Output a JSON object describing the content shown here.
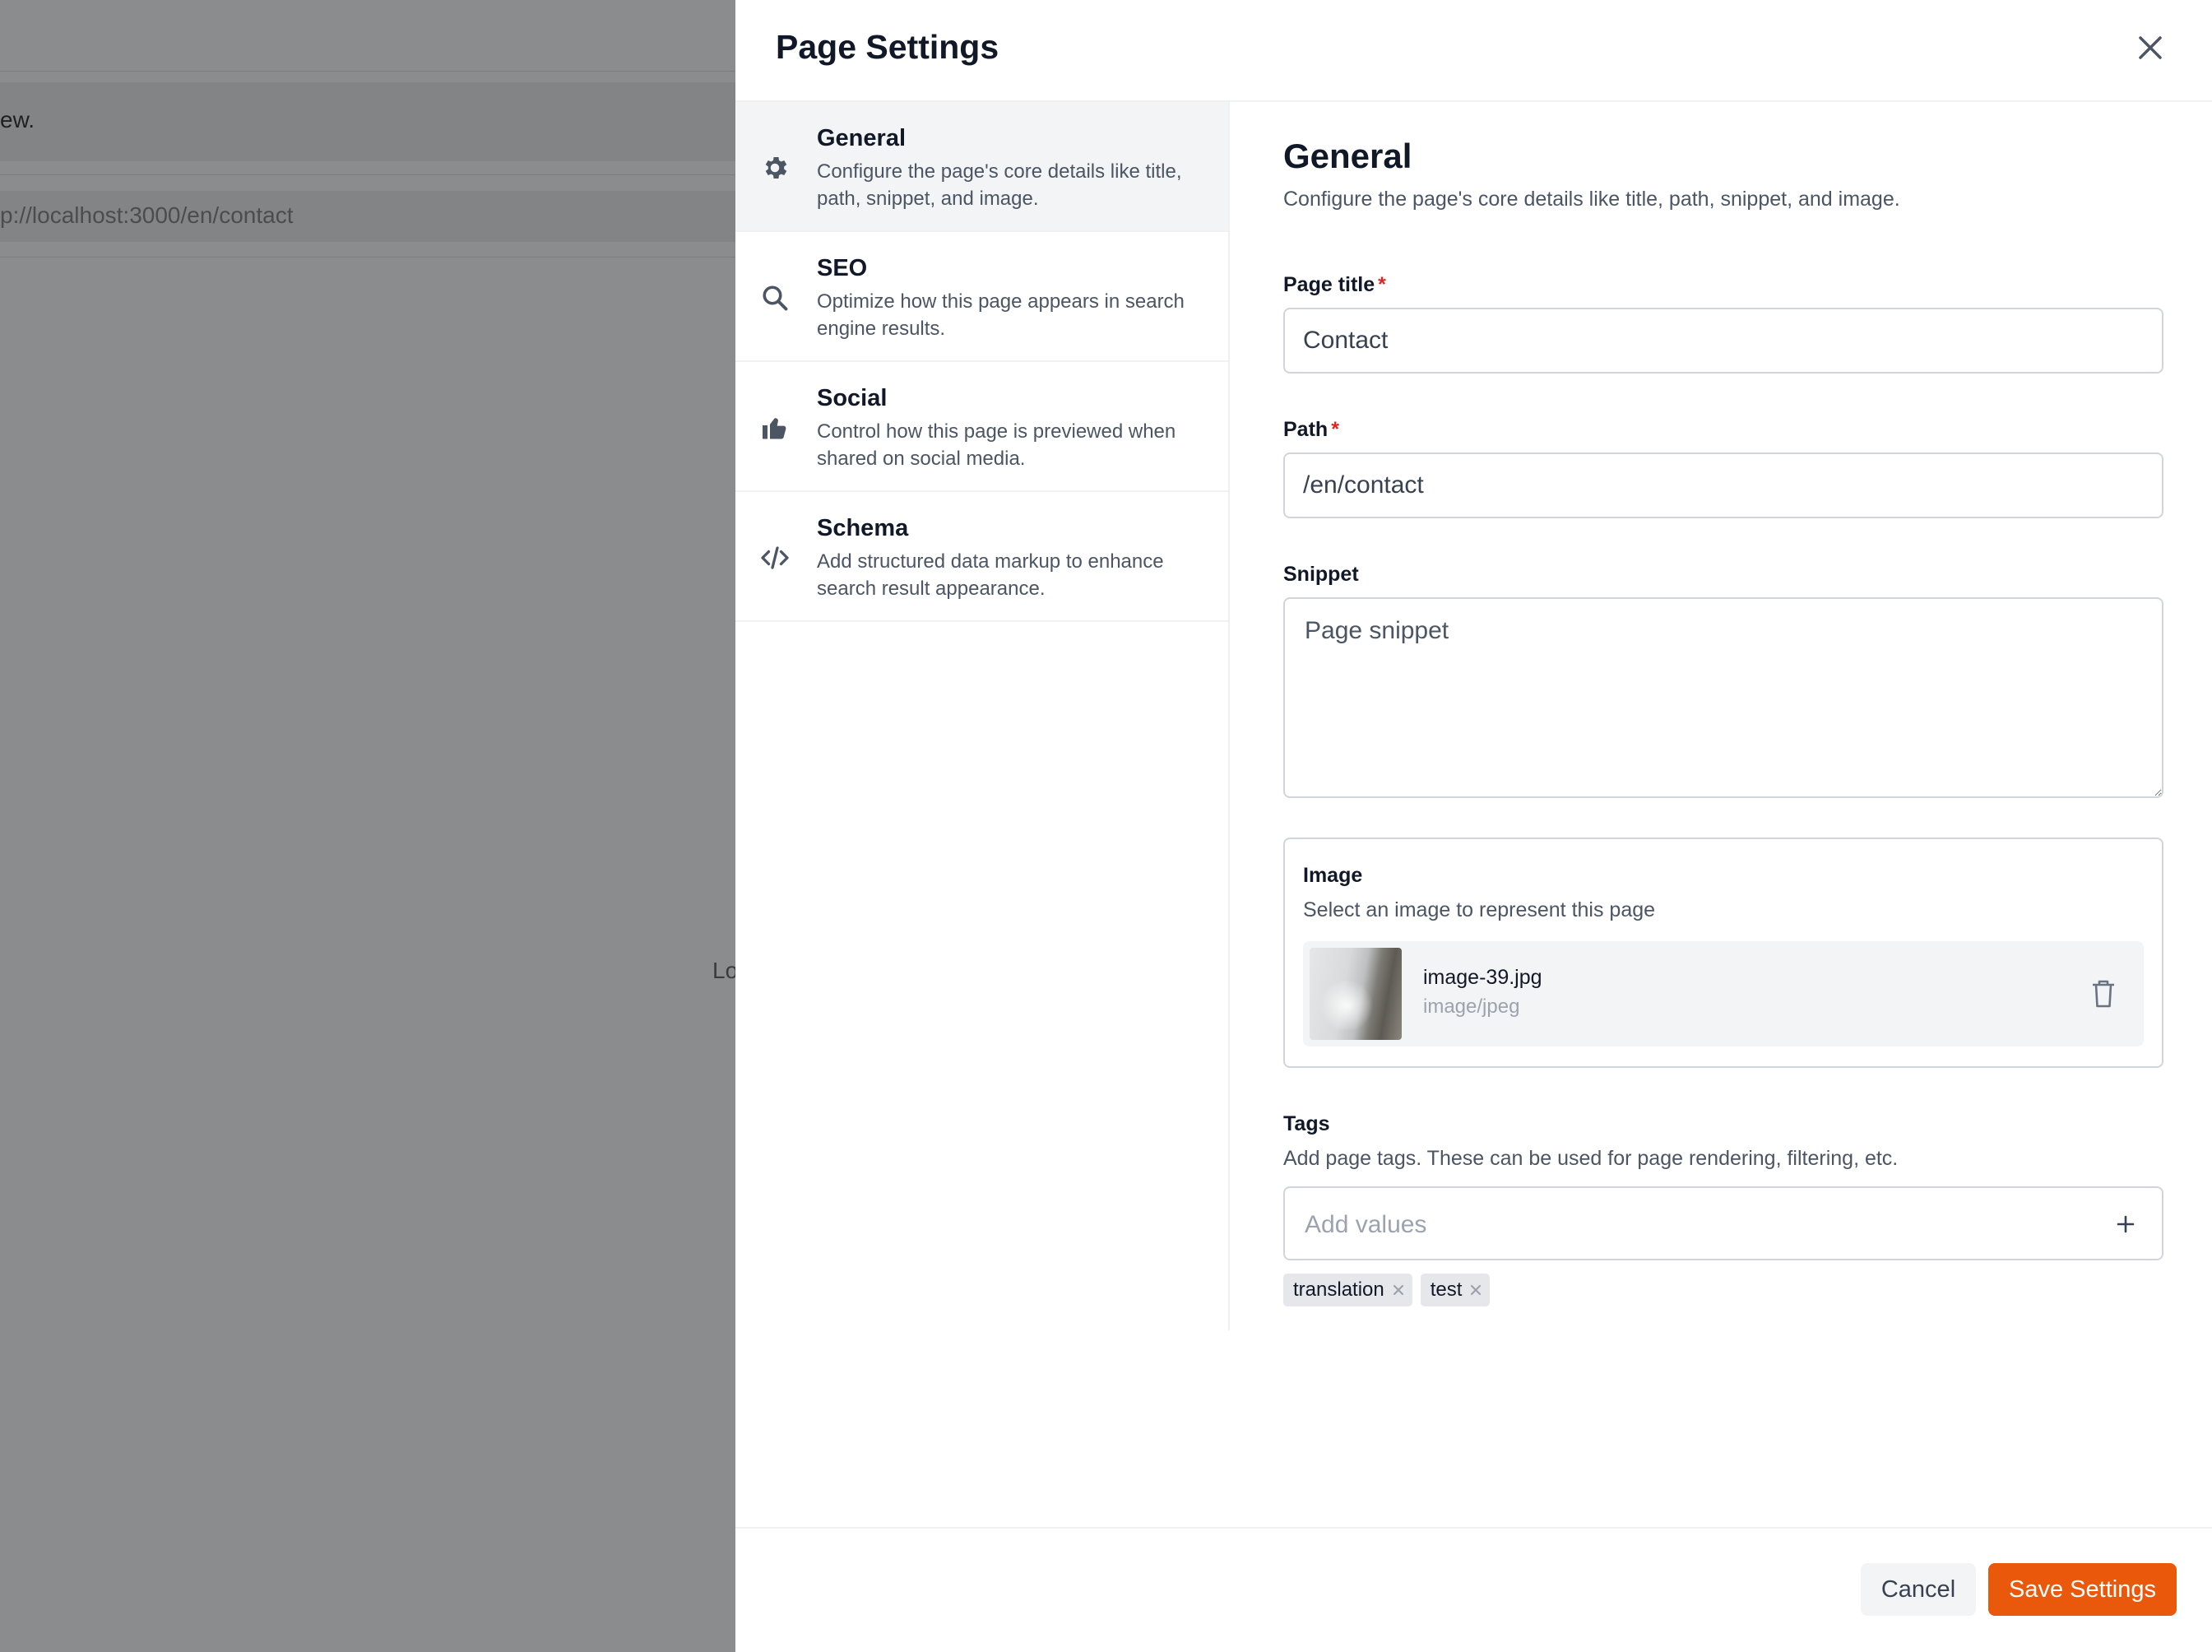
{
  "background": {
    "row1_text": "ew.",
    "url_text": "p://localhost:3000/en/contact",
    "loading_text": "Lo"
  },
  "drawer": {
    "title": "Page Settings"
  },
  "nav": {
    "items": [
      {
        "label": "General",
        "description": "Configure the page's core details like title, path, snippet, and image.",
        "icon": "gear-icon"
      },
      {
        "label": "SEO",
        "description": "Optimize how this page appears in search engine results.",
        "icon": "search-icon"
      },
      {
        "label": "Social",
        "description": "Control how this page is previewed when shared on social media.",
        "icon": "thumbs-up-icon"
      },
      {
        "label": "Schema",
        "description": "Add structured data markup to enhance search result appearance.",
        "icon": "code-icon"
      }
    ],
    "active": "General"
  },
  "general": {
    "title": "General",
    "subtitle": "Configure the page's core details like title, path, snippet, and image.",
    "page_title_label": "Page title",
    "page_title_value": "Contact",
    "path_label": "Path",
    "path_value": "/en/contact",
    "snippet_label": "Snippet",
    "snippet_placeholder": "Page snippet",
    "required_mark": "*"
  },
  "image": {
    "label": "Image",
    "description": "Select an image to represent this page",
    "file_name": "image-39.jpg",
    "file_type": "image/jpeg"
  },
  "tags": {
    "label": "Tags",
    "description": "Add page tags. These can be used for page rendering, filtering, etc.",
    "placeholder": "Add values",
    "items": [
      "translation",
      "test"
    ]
  },
  "footer": {
    "cancel_label": "Cancel",
    "save_label": "Save Settings"
  },
  "colors": {
    "accent": "#ea580c",
    "required": "#dc2626",
    "overlay": "#8b8c8e"
  }
}
